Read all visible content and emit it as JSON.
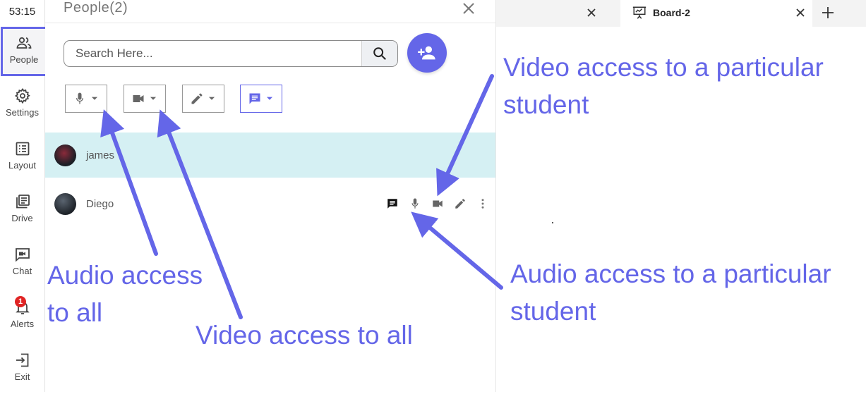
{
  "timer": "53:15",
  "rail": {
    "items": [
      {
        "label": "People"
      },
      {
        "label": "Settings"
      },
      {
        "label": "Layout"
      },
      {
        "label": "Drive"
      },
      {
        "label": "Chat"
      },
      {
        "label": "Alerts",
        "badge": "1"
      },
      {
        "label": "Exit"
      }
    ]
  },
  "panel": {
    "title": "People(2)",
    "search_placeholder": "Search Here...",
    "participants": [
      {
        "name": "james",
        "highlighted": true
      },
      {
        "name": "Diego",
        "highlighted": false
      }
    ]
  },
  "tabs": {
    "active_label": "Board-2"
  },
  "annotations": {
    "audio_all_line1": "Audio access",
    "audio_all_line2": "to all",
    "video_all": "Video access to all",
    "video_particular_line1": "Video access to a particular",
    "video_particular_line2": "student",
    "audio_particular_line1": "Audio access to a particular",
    "audio_particular_line2": "student"
  },
  "colors": {
    "accent": "#6466e8",
    "highlight_row": "#d5f0f3",
    "badge": "#e02424"
  }
}
